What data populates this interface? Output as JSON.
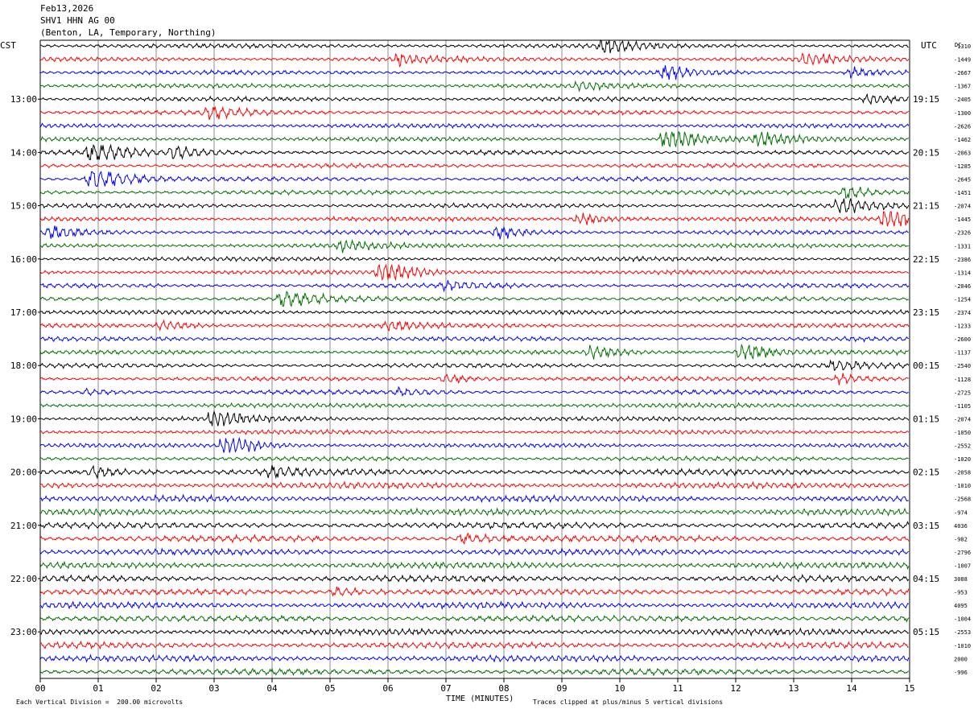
{
  "header": {
    "date": "Feb13,2026",
    "station": "SHV1 HHN AG 00",
    "location": "(Benton, LA, Temporary, Northing)"
  },
  "axes": {
    "left_tz": "CST",
    "right_tz": "UTC",
    "dc_label": "DC"
  },
  "footer": {
    "xlabel": "TIME (MINUTES)",
    "scale_note": "Each Vertical Division =  200.00 microvolts",
    "clip_note": "Traces clipped at plus/minus 5 vertical divisions"
  },
  "colors": {
    "trace_cycle": [
      "#000000",
      "#ff0000",
      "#0000ff",
      "#007000"
    ],
    "grid": "#8c8c8c",
    "axis": "#000000"
  },
  "chart_data": {
    "type": "line",
    "title": "",
    "xlabel": "TIME (MINUTES)",
    "xlim": [
      0,
      15
    ],
    "x_ticks": [
      "00",
      "01",
      "02",
      "03",
      "04",
      "05",
      "06",
      "07",
      "08",
      "09",
      "10",
      "11",
      "12",
      "13",
      "14",
      "15"
    ],
    "rows_per_hour": 4,
    "minutes_per_row": 15,
    "left_hour_labels": [
      "13:00",
      "14:00",
      "15:00",
      "16:00",
      "17:00",
      "18:00",
      "19:00",
      "20:00",
      "21:00",
      "22:00",
      "23:00"
    ],
    "right_hour_labels": [
      "19:15",
      "20:15",
      "21:15",
      "22:15",
      "23:15",
      "00:15",
      "01:15",
      "02:15",
      "03:15",
      "04:15",
      "05:15"
    ],
    "first_labeled_row": 4,
    "dc_offsets": [
      "-1310",
      "-1449",
      "-2667",
      "-1367",
      "-2405",
      "-1300",
      "-2626",
      "-1462",
      "-2063",
      "-1285",
      "-2645",
      "-1451",
      "-2074",
      "-1445",
      "-2326",
      "-1331",
      "-2386",
      "-1314",
      "-2046",
      "-1254",
      "-2374",
      "-1233",
      "-2600",
      "-1137",
      "-2540",
      "-1128",
      "-2725",
      "-1105",
      "-2074",
      "-1050",
      "-2552",
      "-1020",
      "-2058",
      "-1010",
      "-2568",
      "-974",
      "4036",
      "-982",
      "-2796",
      "-1007",
      "3088",
      "-953",
      "4095",
      "-1004",
      "-2553",
      "-1010",
      "2000",
      "-996"
    ],
    "series": [
      {
        "row": 0,
        "events": [
          {
            "minute": 9.7,
            "amp": 2.2
          }
        ]
      },
      {
        "row": 1,
        "events": [
          {
            "minute": 6.2,
            "amp": 1.6
          },
          {
            "minute": 13.2,
            "amp": 1.6
          }
        ]
      },
      {
        "row": 2,
        "events": [
          {
            "minute": 10.8,
            "amp": 2.0
          },
          {
            "minute": 14.0,
            "amp": 1.2
          }
        ]
      },
      {
        "row": 3,
        "events": [
          {
            "minute": 9.3,
            "amp": 1.0
          }
        ]
      },
      {
        "row": 4,
        "events": [
          {
            "minute": 14.3,
            "amp": 1.3
          }
        ]
      },
      {
        "row": 5,
        "events": [
          {
            "minute": 2.9,
            "amp": 1.8
          }
        ]
      },
      {
        "row": 6,
        "events": []
      },
      {
        "row": 7,
        "events": [
          {
            "minute": 10.8,
            "amp": 3.8
          },
          {
            "minute": 12.4,
            "amp": 2.0
          }
        ]
      },
      {
        "row": 8,
        "events": [
          {
            "minute": 0.9,
            "amp": 3.6
          },
          {
            "minute": 2.3,
            "amp": 2.0
          }
        ]
      },
      {
        "row": 9,
        "events": []
      },
      {
        "row": 10,
        "events": [
          {
            "minute": 0.9,
            "amp": 3.6
          }
        ]
      },
      {
        "row": 11,
        "events": [
          {
            "minute": 13.9,
            "amp": 1.6
          }
        ]
      },
      {
        "row": 12,
        "events": [
          {
            "minute": 13.8,
            "amp": 2.5
          }
        ]
      },
      {
        "row": 13,
        "events": [
          {
            "minute": 14.6,
            "amp": 3.2
          },
          {
            "minute": 9.3,
            "amp": 1.5
          }
        ]
      },
      {
        "row": 14,
        "events": [
          {
            "minute": 0.2,
            "amp": 1.6
          },
          {
            "minute": 7.9,
            "amp": 1.6
          }
        ]
      },
      {
        "row": 15,
        "events": [
          {
            "minute": 5.2,
            "amp": 1.4
          }
        ]
      },
      {
        "row": 16,
        "events": []
      },
      {
        "row": 17,
        "events": [
          {
            "minute": 5.9,
            "amp": 3.2
          }
        ]
      },
      {
        "row": 18,
        "events": [
          {
            "minute": 7.0,
            "amp": 1.2
          }
        ]
      },
      {
        "row": 19,
        "events": [
          {
            "minute": 4.2,
            "amp": 2.6
          }
        ]
      },
      {
        "row": 20,
        "events": []
      },
      {
        "row": 21,
        "events": [
          {
            "minute": 2.1,
            "amp": 1.2
          },
          {
            "minute": 6.0,
            "amp": 1.2
          }
        ]
      },
      {
        "row": 22,
        "events": []
      },
      {
        "row": 23,
        "events": [
          {
            "minute": 9.5,
            "amp": 2.0
          },
          {
            "minute": 12.1,
            "amp": 2.6
          }
        ]
      },
      {
        "row": 24,
        "events": [
          {
            "minute": 13.7,
            "amp": 1.2
          }
        ]
      },
      {
        "row": 25,
        "events": [
          {
            "minute": 7.0,
            "amp": 1.2
          },
          {
            "minute": 13.8,
            "amp": 1.2
          }
        ]
      },
      {
        "row": 26,
        "events": [
          {
            "minute": 0.8,
            "amp": 0.8
          },
          {
            "minute": 6.2,
            "amp": 1.0
          }
        ]
      },
      {
        "row": 27,
        "events": []
      },
      {
        "row": 28,
        "events": [
          {
            "minute": 3.0,
            "amp": 2.6
          }
        ]
      },
      {
        "row": 29,
        "events": []
      },
      {
        "row": 30,
        "events": [
          {
            "minute": 3.2,
            "amp": 3.4
          }
        ]
      },
      {
        "row": 31,
        "events": []
      },
      {
        "row": 32,
        "events": [
          {
            "minute": 0.9,
            "amp": 1.4
          },
          {
            "minute": 4.0,
            "amp": 1.2
          }
        ]
      },
      {
        "row": 33,
        "events": []
      },
      {
        "row": 34,
        "events": []
      },
      {
        "row": 35,
        "events": []
      },
      {
        "row": 36,
        "events": []
      },
      {
        "row": 37,
        "events": [
          {
            "minute": 7.3,
            "amp": 1.2
          }
        ]
      },
      {
        "row": 38,
        "events": []
      },
      {
        "row": 39,
        "events": []
      },
      {
        "row": 40,
        "events": []
      },
      {
        "row": 41,
        "events": [
          {
            "minute": 5.1,
            "amp": 1.0
          }
        ]
      },
      {
        "row": 42,
        "events": []
      },
      {
        "row": 43,
        "events": []
      },
      {
        "row": 44,
        "events": []
      },
      {
        "row": 45,
        "events": []
      },
      {
        "row": 46,
        "events": []
      },
      {
        "row": 47,
        "events": []
      }
    ]
  }
}
